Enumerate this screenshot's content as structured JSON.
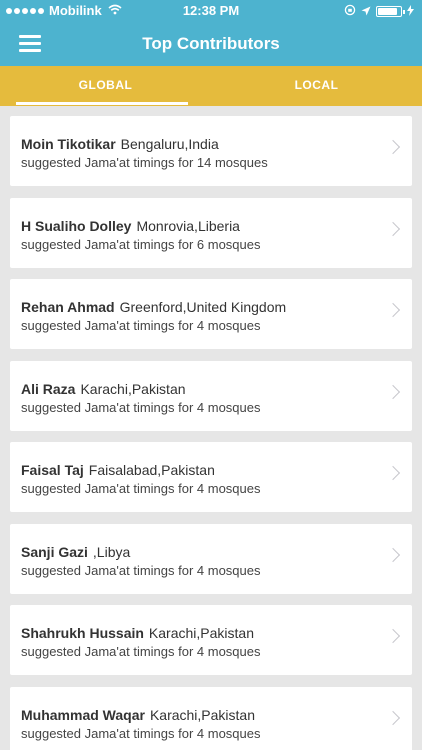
{
  "status_bar": {
    "carrier": "Mobilink",
    "time": "12:38 PM",
    "battery_level": 0.85
  },
  "nav": {
    "title": "Top Contributors",
    "menu_icon": "hamburger-menu-icon"
  },
  "tabs": [
    {
      "label": "GLOBAL",
      "selected": true
    },
    {
      "label": "LOCAL",
      "selected": false
    }
  ],
  "contributors": [
    {
      "name": "Moin Tikotikar",
      "location": "Bengaluru,India",
      "summary": "suggested Jama'at timings for 14 mosques"
    },
    {
      "name": "H Sualiho Dolley",
      "location": "Monrovia,Liberia",
      "summary": "suggested Jama'at timings for 6 mosques"
    },
    {
      "name": "Rehan Ahmad",
      "location": "Greenford,United Kingdom",
      "summary": "suggested Jama'at timings for 4 mosques"
    },
    {
      "name": "Ali Raza",
      "location": "Karachi,Pakistan",
      "summary": "suggested Jama'at timings for 4 mosques"
    },
    {
      "name": "Faisal Taj",
      "location": "Faisalabad,Pakistan",
      "summary": "suggested Jama'at timings for 4 mosques"
    },
    {
      "name": "Sanji Gazi",
      "location": ",Libya",
      "summary": "suggested Jama'at timings for 4 mosques"
    },
    {
      "name": "Shahrukh Hussain",
      "location": "Karachi,Pakistan",
      "summary": "suggested Jama'at timings for 4 mosques"
    },
    {
      "name": "Muhammad Waqar",
      "location": "Karachi,Pakistan",
      "summary": "suggested Jama'at timings for 4 mosques"
    }
  ],
  "colors": {
    "header": "#4db3cf",
    "tab_bar": "#e5bb3d",
    "background": "#e6e6e6"
  }
}
